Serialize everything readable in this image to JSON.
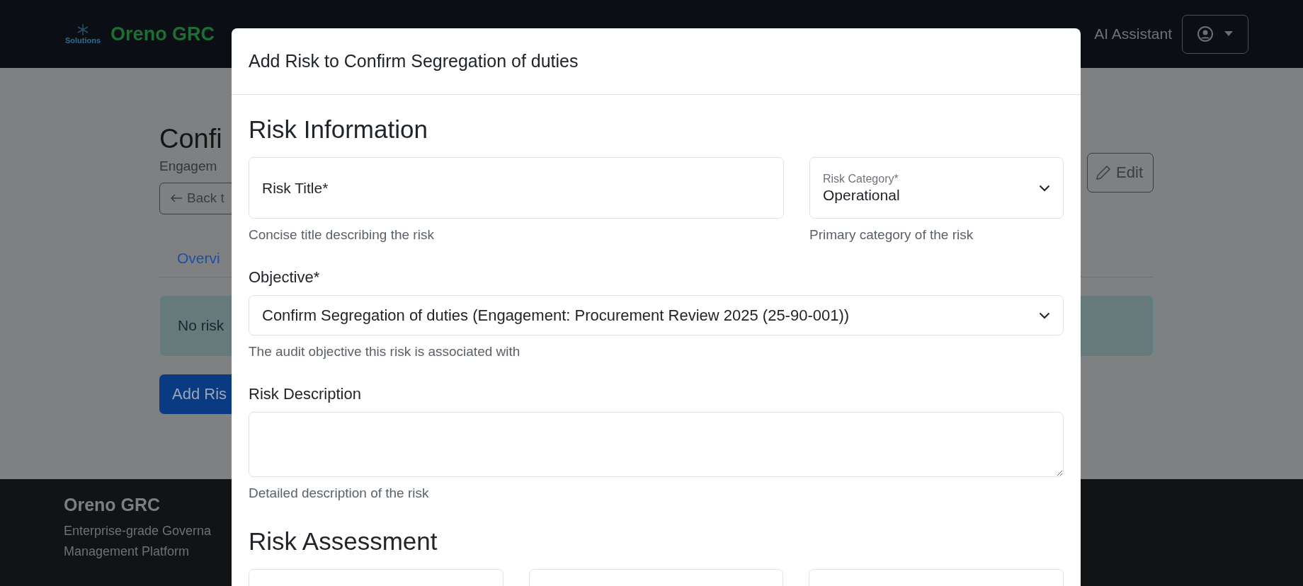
{
  "navbar": {
    "logo_text": "Solutions",
    "brand": "Oreno GRC",
    "ai_assistant": "AI Assistant"
  },
  "page": {
    "title": "Confi",
    "subtitle": "Engagem",
    "back_button": "Back t",
    "edit_button": "Edit",
    "tabs": [
      {
        "label": "Overvi",
        "selected": false
      }
    ],
    "alert": "No risk",
    "add_button": "Add Ris"
  },
  "footer": {
    "brand": "Oreno GRC",
    "description": [
      "Enterprise-grade Governa",
      "Management Platform"
    ]
  },
  "modal": {
    "title": "Add Risk to Confirm Segregation of duties",
    "sections": [
      {
        "heading": "Risk Information",
        "rows": [
          {
            "fields": [
              {
                "kind": "floating-input",
                "placeholder": "Risk Title*",
                "help": "Concise title describing the risk"
              },
              {
                "kind": "floating-select",
                "label": "Risk Category*",
                "value": "Operational",
                "help": "Primary category of the risk"
              }
            ]
          },
          {
            "fields": [
              {
                "kind": "select",
                "label": "Objective*",
                "value": "Confirm Segregation of duties (Engagement: Procurement Review 2025 (25-90-001))",
                "help": "The audit objective this risk is associated with"
              }
            ]
          },
          {
            "fields": [
              {
                "kind": "textarea",
                "label": "Risk Description",
                "help": "Detailed description of the risk"
              }
            ]
          }
        ]
      },
      {
        "heading": "Risk Assessment",
        "rows": [
          {
            "fields": [
              {
                "kind": "blank"
              },
              {
                "kind": "blank"
              },
              {
                "kind": "blank"
              }
            ]
          }
        ]
      }
    ]
  }
}
